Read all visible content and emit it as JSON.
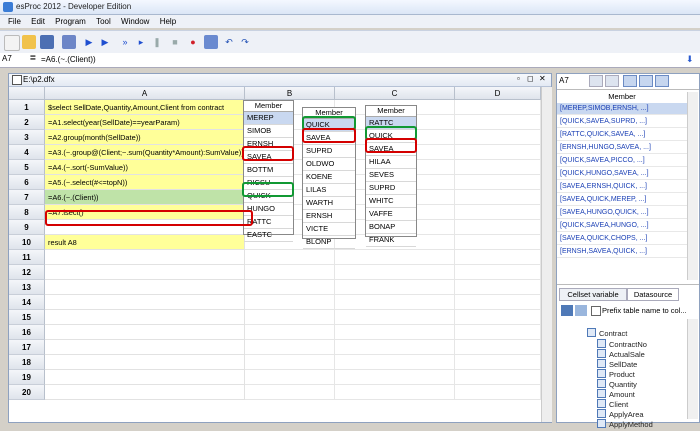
{
  "app": {
    "title": "esProc 2012 - Developer Edition"
  },
  "menu": [
    "File",
    "Edit",
    "Program",
    "Tool",
    "Window",
    "Help"
  ],
  "formula": {
    "cell": "A7",
    "eq": "=",
    "value": "=A6.(~.(Client))"
  },
  "doc": {
    "title": "E:\\p2.dfx",
    "col_a": "A",
    "col_b": "B",
    "col_c": "C",
    "col_d": "D"
  },
  "rows": [
    {
      "n": "1",
      "text": "$select SellDate,Quantity,Amount,Client from contract"
    },
    {
      "n": "2",
      "text": "=A1.select(year(SellDate)==yearParam)"
    },
    {
      "n": "3",
      "text": "=A2.group(month(SellDate))"
    },
    {
      "n": "4",
      "text": "=A3.(~.group@(Client;~.sum(Quantity*Amount):SumValue))"
    },
    {
      "n": "5",
      "text": "=A4.(~.sort(-SumValue))"
    },
    {
      "n": "6",
      "text": "=A5.(~.select(#<=topN))"
    },
    {
      "n": "7",
      "text": "=A6.(~.(Client))"
    },
    {
      "n": "8",
      "text": "=A7.isect()"
    },
    {
      "n": "9",
      "text": ""
    },
    {
      "n": "10",
      "text": "result A8"
    },
    {
      "n": "11",
      "text": ""
    },
    {
      "n": "12",
      "text": ""
    },
    {
      "n": "13",
      "text": ""
    },
    {
      "n": "14",
      "text": ""
    },
    {
      "n": "15",
      "text": ""
    },
    {
      "n": "16",
      "text": ""
    },
    {
      "n": "17",
      "text": ""
    },
    {
      "n": "18",
      "text": ""
    },
    {
      "n": "19",
      "text": ""
    },
    {
      "n": "20",
      "text": ""
    }
  ],
  "member_tables": {
    "header": "Member",
    "t1": [
      "MEREP",
      "SIMOB",
      "ERNSH",
      "SAVEA",
      "BOTTM",
      "RICSU",
      "QUICK",
      "HUNGO",
      "RATTC",
      "EASTC"
    ],
    "t2": [
      "QUICK",
      "SAVEA",
      "SUPRD",
      "OLDWO",
      "KOENE",
      "LILAS",
      "WARTH",
      "ERNSH",
      "VICTE",
      "BLONP"
    ],
    "t3": [
      "RATTC",
      "QUICK",
      "SAVEA",
      "HILAA",
      "SEVES",
      "SUPRD",
      "WHITC",
      "VAFFE",
      "BONAP",
      "FRANK"
    ]
  },
  "right_panel": {
    "cell": "A7",
    "header": "Member",
    "items": [
      "[MEREP,SIMOB,ERNSH, ...]",
      "[QUICK,SAVEA,SUPRD, ...]",
      "[RATTC,QUICK,SAVEA, ...]",
      "[ERNSH,HUNGO,SAVEA, ...]",
      "[QUICK,SAVEA,PICCO, ...]",
      "[QUICK,HUNGO,SAVEA, ...]",
      "[SAVEA,ERNSH,QUICK, ...]",
      "[SAVEA,QUICK,MEREP, ...]",
      "[SAVEA,HUNGO,QUICK, ...]",
      "[QUICK,SAVEA,HUNGO, ...]",
      "[SAVEA,QUICK,CHOPS, ...]",
      "[ERNSH,SAVEA,QUICK, ...]"
    ],
    "tabs": [
      "Cellset variable",
      "Datasource"
    ],
    "prefix_label": "Prefix table name to col...",
    "tree_root": "Contract",
    "tree_items": [
      "ContractNo",
      "ActualSale",
      "SellDate",
      "Product",
      "Quantity",
      "Amount",
      "Client",
      "ApplyArea",
      "ApplyMethod"
    ]
  }
}
